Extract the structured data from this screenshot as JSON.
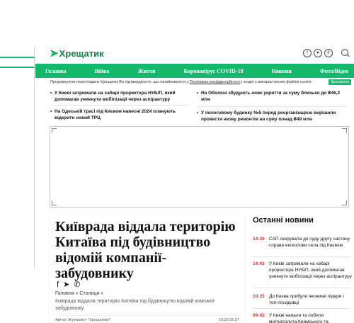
{
  "header": {
    "logo_text": "Хрещатик",
    "socials": [
      "facebook-icon",
      "telegram-icon",
      "phone-icon"
    ]
  },
  "nav": {
    "items": [
      "Головна",
      "Війна",
      "Життя",
      "Коронавірус COVID-19",
      "Новини",
      "Фото/Відео"
    ]
  },
  "cookie": {
    "text_before": "Продовжуючи переглядати Хрещатик Ви підтверджуєте, що ознайомилися з",
    "link": "Політикою конфіденційності",
    "text_after": "і згодні з використанням файлів cookie.",
    "button": "Зрозуміло"
  },
  "top_news": {
    "left": [
      "У Києві затримали на хабарі проректора НУБіП, який допомагав уникнути мобілізації через аспірантуру",
      "На Одеській трасі під Києвом навесні 2024 планують відкрити новий ТРЦ"
    ],
    "right": [
      "На Оболоні збудують нове укриття за суму близько до ₴46,2 млн",
      "У пологовому будинку №5 перед реорганізацією вирішили провести низку ремонтів на суму понад ₴49 млн"
    ]
  },
  "article": {
    "title": "Київрада віддала територію Китаїва під будівництво відомій компанії-забудовнику",
    "breadcrumb_home": "Головна",
    "breadcrumb_section": "Столиця",
    "breadcrumb_sep": "»",
    "breadcrumb_desc": "Київрада віддала територію Китаїва під будівництво відомій компанії-забудовнику",
    "author": "Автор: Журналіст \"Хрещатику\"",
    "time": "19:33 05.07"
  },
  "sidebar": {
    "title": "Останні новини",
    "items": [
      {
        "time": "14:39",
        "text": "САП скерувала до суду другу частину справи ексколови села під Києвом"
      },
      {
        "time": "14:43",
        "text": "У Києві затримали на хабарі проректора НУБіП, який допомагав уникнути мобілізації через аспірантуру"
      },
      {
        "time": "10:25",
        "text": "До Києва прибули іноземні лідери і топ-посадовці"
      },
      {
        "time": "09:45",
        "text": "У Києві напали та побили митрополита Кримського та"
      }
    ]
  }
}
